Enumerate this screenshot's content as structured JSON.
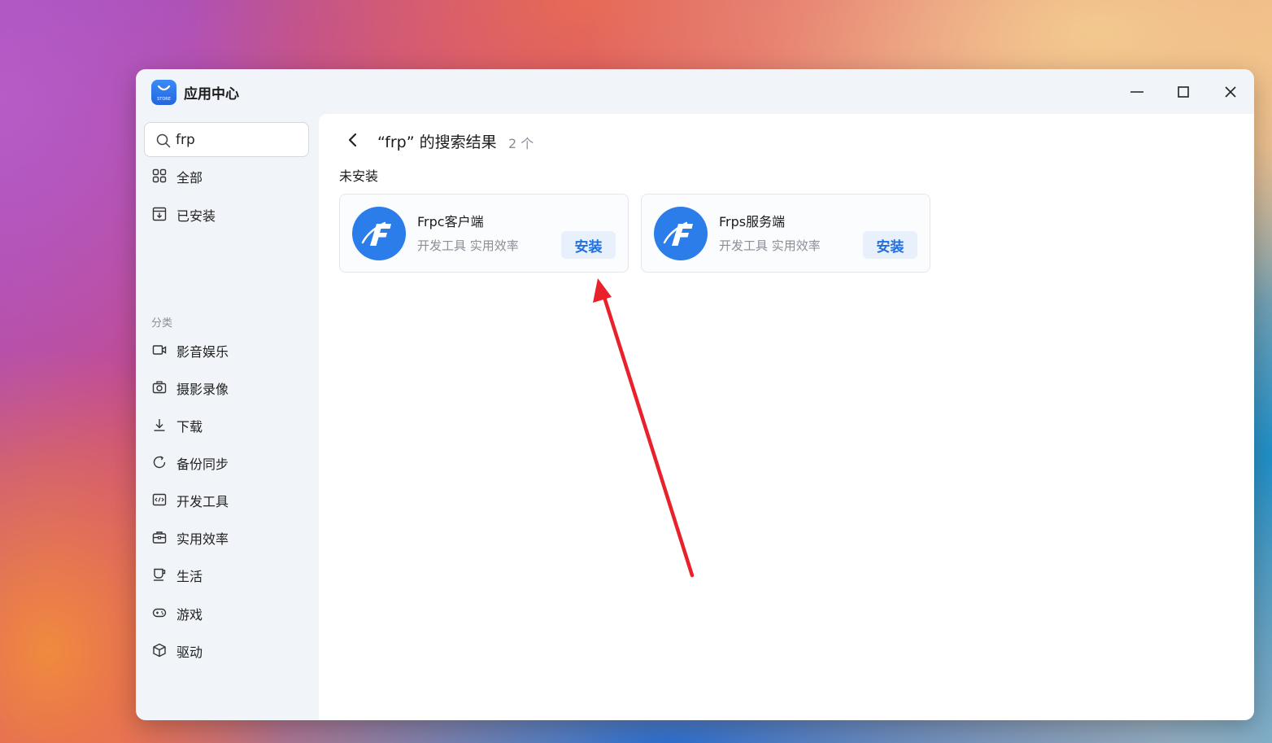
{
  "window": {
    "title": "应用中心",
    "logo_icon": "store-bag-icon",
    "logo_text": "STORE",
    "controls": [
      "minimize-icon",
      "maximize-icon",
      "close-icon"
    ]
  },
  "sidebar": {
    "search": {
      "value": "frp",
      "icon": "search-icon"
    },
    "top_items": [
      {
        "label": "全部",
        "icon": "grid-icon"
      },
      {
        "label": "已安装",
        "icon": "installed-box-icon"
      }
    ],
    "section_label": "分类",
    "categories": [
      {
        "label": "影音娱乐",
        "icon": "video-camera-icon"
      },
      {
        "label": "摄影录像",
        "icon": "camera-icon"
      },
      {
        "label": "下载",
        "icon": "download-icon"
      },
      {
        "label": "备份同步",
        "icon": "sync-icon"
      },
      {
        "label": "开发工具",
        "icon": "code-icon"
      },
      {
        "label": "实用效率",
        "icon": "toolbox-icon"
      },
      {
        "label": "生活",
        "icon": "cup-icon"
      },
      {
        "label": "游戏",
        "icon": "gamepad-icon"
      },
      {
        "label": "驱动",
        "icon": "cube-icon"
      }
    ]
  },
  "main": {
    "back_icon": "chevron-left-icon",
    "result_title": "“frp” 的搜索结果",
    "result_count": "2 个",
    "group_label": "未安装",
    "apps": [
      {
        "name": "Frpc客户端",
        "description": "开发工具 实用效率",
        "install_label": "安装",
        "icon": "frp-logo-icon"
      },
      {
        "name": "Frps服务端",
        "description": "开发工具 实用效率",
        "install_label": "安装",
        "icon": "frp-logo-icon"
      }
    ]
  },
  "annotation": {
    "type": "arrow",
    "color": "#e8212a",
    "points_to": "Frpc客户端 安装"
  },
  "colors": {
    "accent": "#2b7de9",
    "install_text": "#1f6fe0",
    "install_bg": "#e8f0fb",
    "sidebar_bg": "#f1f4f8"
  }
}
